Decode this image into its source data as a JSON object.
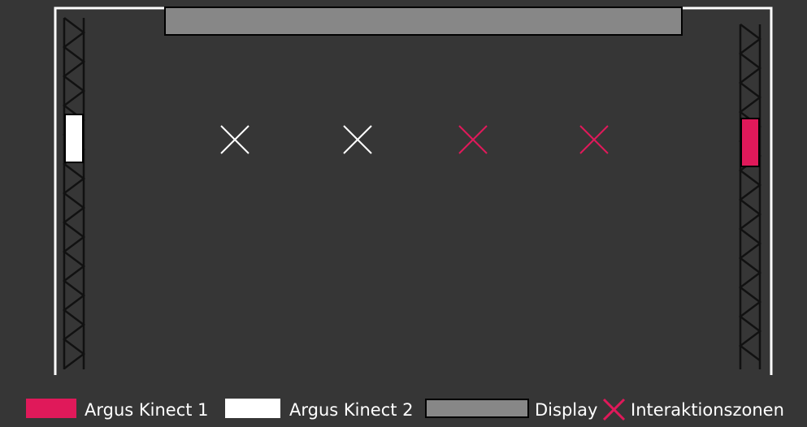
{
  "colors": {
    "background": "#363636",
    "kinect1": "#e0195a",
    "kinect2": "#ffffff",
    "display": "#878787",
    "zone_white": "#ffffff",
    "zone_pink": "#e0195a",
    "truss": "#111111",
    "wall": "#ffffff"
  },
  "icons": [
    "truss-left",
    "truss-right",
    "cross-icon"
  ],
  "legend": {
    "kinect1_label": "Argus Kinect 1",
    "kinect2_label": "Argus Kinect 2",
    "display_label": "Display",
    "zones_label": "Interaktionszonen"
  },
  "diagram": {
    "interaction_zones": [
      {
        "sensor": "Argus Kinect 2"
      },
      {
        "sensor": "Argus Kinect 2"
      },
      {
        "sensor": "Argus Kinect 1"
      },
      {
        "sensor": "Argus Kinect 1"
      }
    ]
  }
}
